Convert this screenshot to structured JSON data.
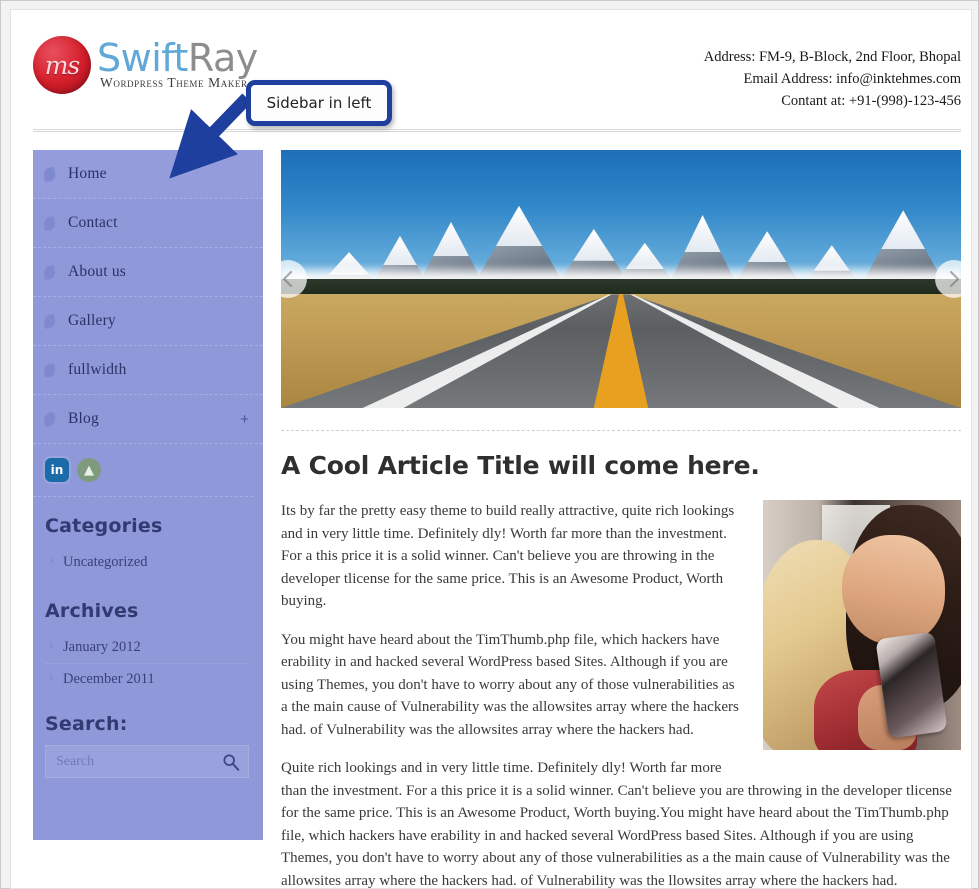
{
  "header": {
    "logo_initials": "ms",
    "brand_part1": "Swift",
    "brand_part2": "Ray",
    "tagline": "Wordpress Theme Maker",
    "contact": {
      "address": "Address: FM-9, B-Block, 2nd Floor, Bhopal",
      "email": "Email Address: info@inktehmes.com",
      "phone": "Contant at: +91-(998)-123-456"
    }
  },
  "annotation": {
    "callout_text": "Sidebar in left"
  },
  "sidebar": {
    "nav_items": [
      {
        "label": "Home",
        "icon": "leaf-bullet-icon",
        "active": true,
        "expander": ""
      },
      {
        "label": "Contact",
        "icon": "leaf-bullet-icon",
        "active": false,
        "expander": ""
      },
      {
        "label": "About us",
        "icon": "leaf-bullet-icon",
        "active": false,
        "expander": ""
      },
      {
        "label": "Gallery",
        "icon": "leaf-bullet-icon",
        "active": false,
        "expander": ""
      },
      {
        "label": "fullwidth",
        "icon": "leaf-bullet-icon",
        "active": false,
        "expander": ""
      },
      {
        "label": "Blog",
        "icon": "leaf-bullet-icon",
        "active": false,
        "expander": "+"
      }
    ],
    "social": [
      {
        "name": "linkedin-icon",
        "glyph": "in"
      },
      {
        "name": "android-icon",
        "glyph": "▲"
      }
    ],
    "categories": {
      "title": "Categories",
      "items": [
        "Uncategorized"
      ]
    },
    "archives": {
      "title": "Archives",
      "items": [
        "January 2012",
        "December 2011"
      ]
    },
    "search": {
      "title": "Search:",
      "placeholder": "Search",
      "value": "",
      "icon": "magnifier-icon"
    },
    "background_color": "#8f98d9",
    "text_color": "#2b3266"
  },
  "main": {
    "slider": {
      "prev_label": "‹",
      "next_label": "›",
      "image_alt": "Road leading toward snow-capped mountain range under blue sky"
    },
    "article": {
      "title": "A Cool Article Title will come here.",
      "photo_alt": "Two young women smiling at a mobile phone",
      "paragraphs": [
        "Its by far the pretty easy theme to build really attractive, quite rich lookings and in very little time. Definitely dly! Worth far more than the investment. For a this price it is a solid winner. Can't believe you are throwing in the developer tlicense for the same price. This is an Awesome Product, Worth buying.",
        "You might have heard about the TimThumb.php file, which hackers have erability in and hacked several WordPress based Sites. Although if you are using Themes, you don't have to worry about any of those vulnerabilities as a the main cause of Vulnerability was the allowsites array where the hackers had. of Vulnerability was the allowsites array where the hackers had.",
        "Quite rich lookings and in very little time. Definitely dly! Worth far more than the investment. For a this price it is a solid winner. Can't believe you are throwing in the developer tlicense for the same price. This is an Awesome Product, Worth buying.You might have heard about the TimThumb.php file, which hackers have erability in and hacked several WordPress based Sites. Although if you are using Themes, you don't have to worry about any of those vulnerabilities as a the main cause of Vulnerability was the allowsites array where the hackers had. of Vulnerability was the llowsites array where the hackers had."
      ]
    }
  }
}
